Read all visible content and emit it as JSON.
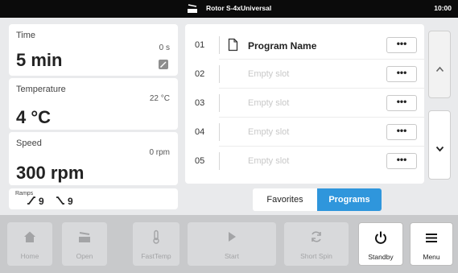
{
  "status_bar": {
    "rotor": "Rotor S-4xUniversal",
    "time": "10:00"
  },
  "params": {
    "time": {
      "label": "Time",
      "current": "0 s",
      "value": "5 min"
    },
    "temperature": {
      "label": "Temperature",
      "current": "22 °C",
      "value": "4 °C"
    },
    "speed": {
      "label": "Speed",
      "current": "0 rpm",
      "value": "300 rpm"
    }
  },
  "ramps": {
    "label": "Ramps",
    "accel": "9",
    "decel": "9"
  },
  "programs": [
    {
      "num": "01",
      "name": "Program Name",
      "empty": false,
      "more": "•••"
    },
    {
      "num": "02",
      "name": "Empty slot",
      "empty": true,
      "more": "•••"
    },
    {
      "num": "03",
      "name": "Empty slot",
      "empty": true,
      "more": "•••"
    },
    {
      "num": "04",
      "name": "Empty slot",
      "empty": true,
      "more": "•••"
    },
    {
      "num": "05",
      "name": "Empty slot",
      "empty": true,
      "more": "•••"
    }
  ],
  "tabs": {
    "favorites": "Favorites",
    "programs": "Programs",
    "active": "programs"
  },
  "toolbar": {
    "home": "Home",
    "open": "Open",
    "fasttemp": "FastTemp",
    "start": "Start",
    "short_spin": "Short Spin",
    "standby": "Standby",
    "menu": "Menu"
  },
  "icons": {
    "rotor": "rotor-lid-icon",
    "edit": "edit-pencil-icon",
    "doc": "document-icon",
    "ramp_up": "ramp-up-icon",
    "ramp_down": "ramp-down-icon",
    "scroll_up": "chevron-up-icon",
    "scroll_down": "chevron-down-icon",
    "home": "home-icon",
    "open": "open-lid-icon",
    "fasttemp": "thermometer-icon",
    "start": "play-icon",
    "short_spin": "refresh-icon",
    "standby": "power-icon",
    "menu": "hamburger-menu-icon"
  },
  "colors": {
    "accent": "#2f96dc",
    "status_bar": "#0b0b0b",
    "toolbar_bg": "#c8c9cb"
  }
}
